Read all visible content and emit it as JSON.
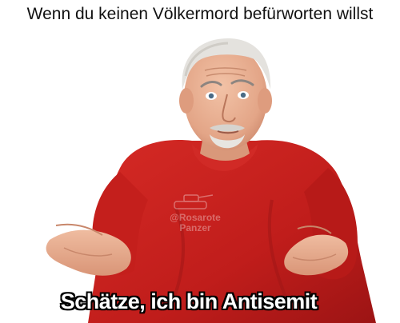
{
  "meme": {
    "top_caption": "Wenn du keinen Völkermord befürworten willst",
    "bottom_caption": "Schätze, ich bin Antisemit",
    "watermark": {
      "handle": "@Rosarote",
      "name": "Panzer"
    },
    "colors": {
      "sweater": "#c8201e",
      "background": "#ffffff",
      "caption_fill": "#ffffff",
      "caption_outline": "#000000"
    }
  }
}
